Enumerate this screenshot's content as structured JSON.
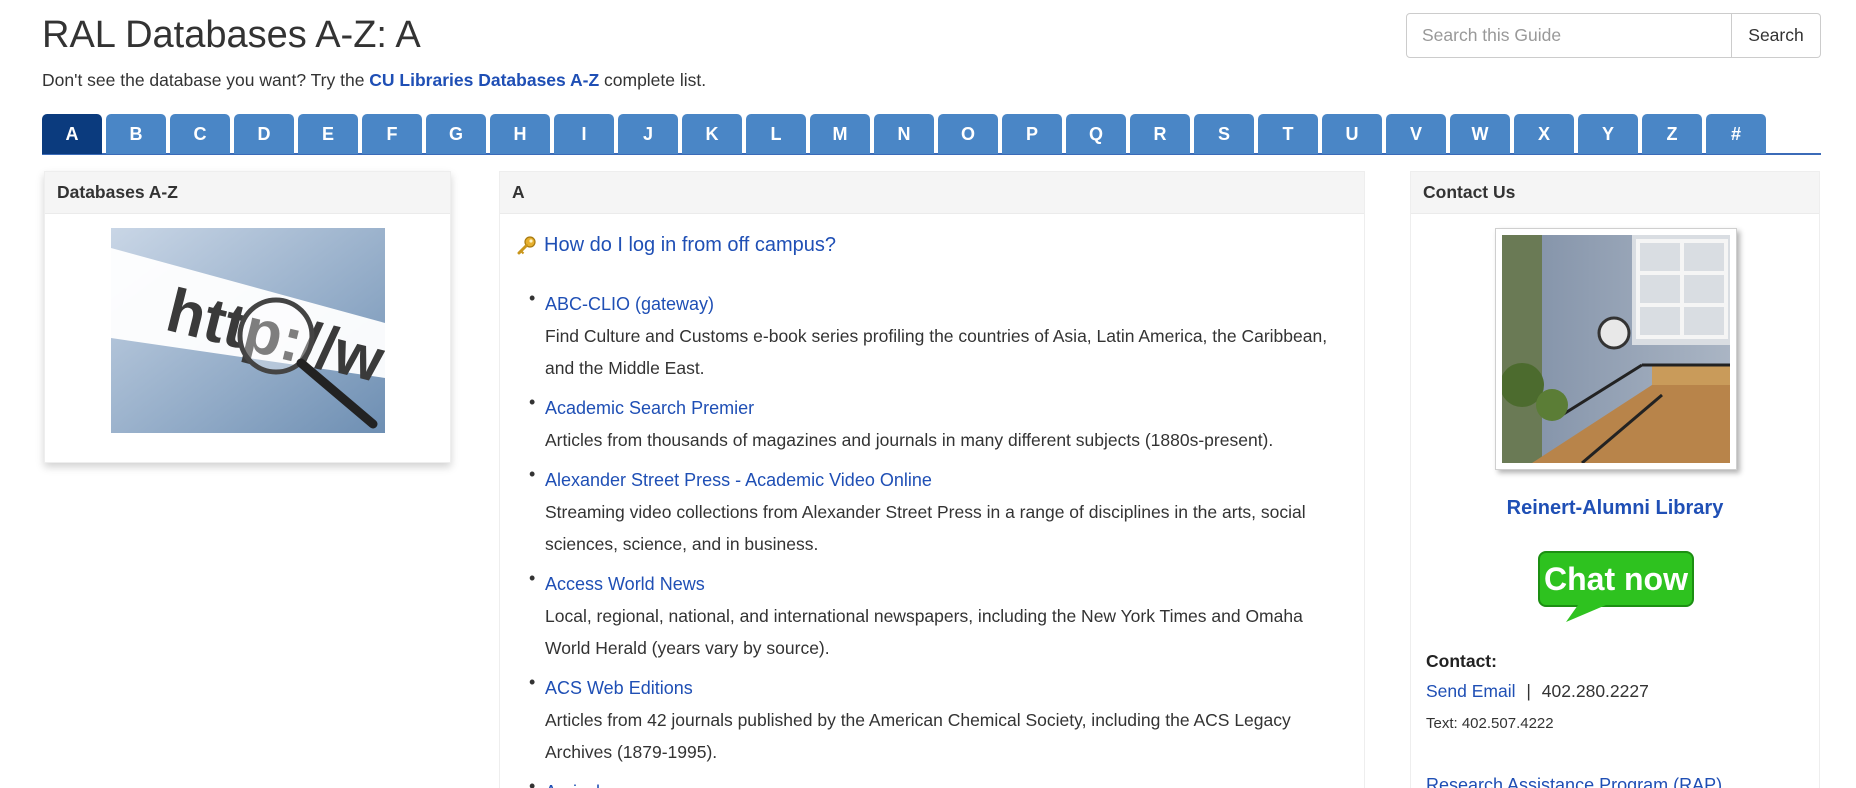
{
  "page": {
    "title": "RAL Databases A-Z: A",
    "intro_before": "Don't see the database you want? Try the ",
    "intro_link": "CU Libraries Databases A-Z",
    "intro_after": " complete list."
  },
  "search": {
    "placeholder": "Search this Guide",
    "button_label": "Search"
  },
  "letters": [
    "A",
    "B",
    "C",
    "D",
    "E",
    "F",
    "G",
    "H",
    "I",
    "J",
    "K",
    "L",
    "M",
    "N",
    "O",
    "P",
    "Q",
    "R",
    "S",
    "T",
    "U",
    "V",
    "W",
    "X",
    "Y",
    "Z",
    "#"
  ],
  "active_letter": "A",
  "left_box": {
    "heading": "Databases A-Z",
    "image_text": "http://www."
  },
  "main": {
    "heading": "A",
    "login_link": "How do I log in from off campus?",
    "databases": [
      {
        "name": "ABC-CLIO (gateway)",
        "description": "Find Culture and Customs e-book series profiling the countries of Asia, Latin America, the Caribbean, and the Middle East."
      },
      {
        "name": "Academic Search Premier",
        "description": "Articles from thousands of magazines and journals in many different subjects (1880s-present)."
      },
      {
        "name": "Alexander Street Press - Academic Video Online",
        "description": "Streaming video collections from Alexander Street Press in a range of disciplines in the arts, social sciences, science, and in business."
      },
      {
        "name": "Access World News",
        "description": "Local, regional, national, and international newspapers, including the New York Times and Omaha World Herald (years vary by source)."
      },
      {
        "name": "ACS Web Editions",
        "description": "Articles from 42 journals published by the American Chemical Society, including the ACS Legacy Archives (1879-1995)."
      },
      {
        "name": "Agricola",
        "description": ""
      }
    ]
  },
  "contact": {
    "heading": "Contact Us",
    "library_name": "Reinert-Alumni Library",
    "chat_label": "Chat now",
    "contact_label": "Contact:",
    "email_link": "Send Email",
    "separator": "|",
    "phone": "402.280.2227",
    "text_line": "Text: 402.507.4222",
    "rap_link": "Research Assistance Program (RAP)"
  },
  "colors": {
    "tab": "#4a86c6",
    "tab_active": "#0b3b7e",
    "link": "#1f4fb5",
    "chat_green": "#2ec21f"
  }
}
